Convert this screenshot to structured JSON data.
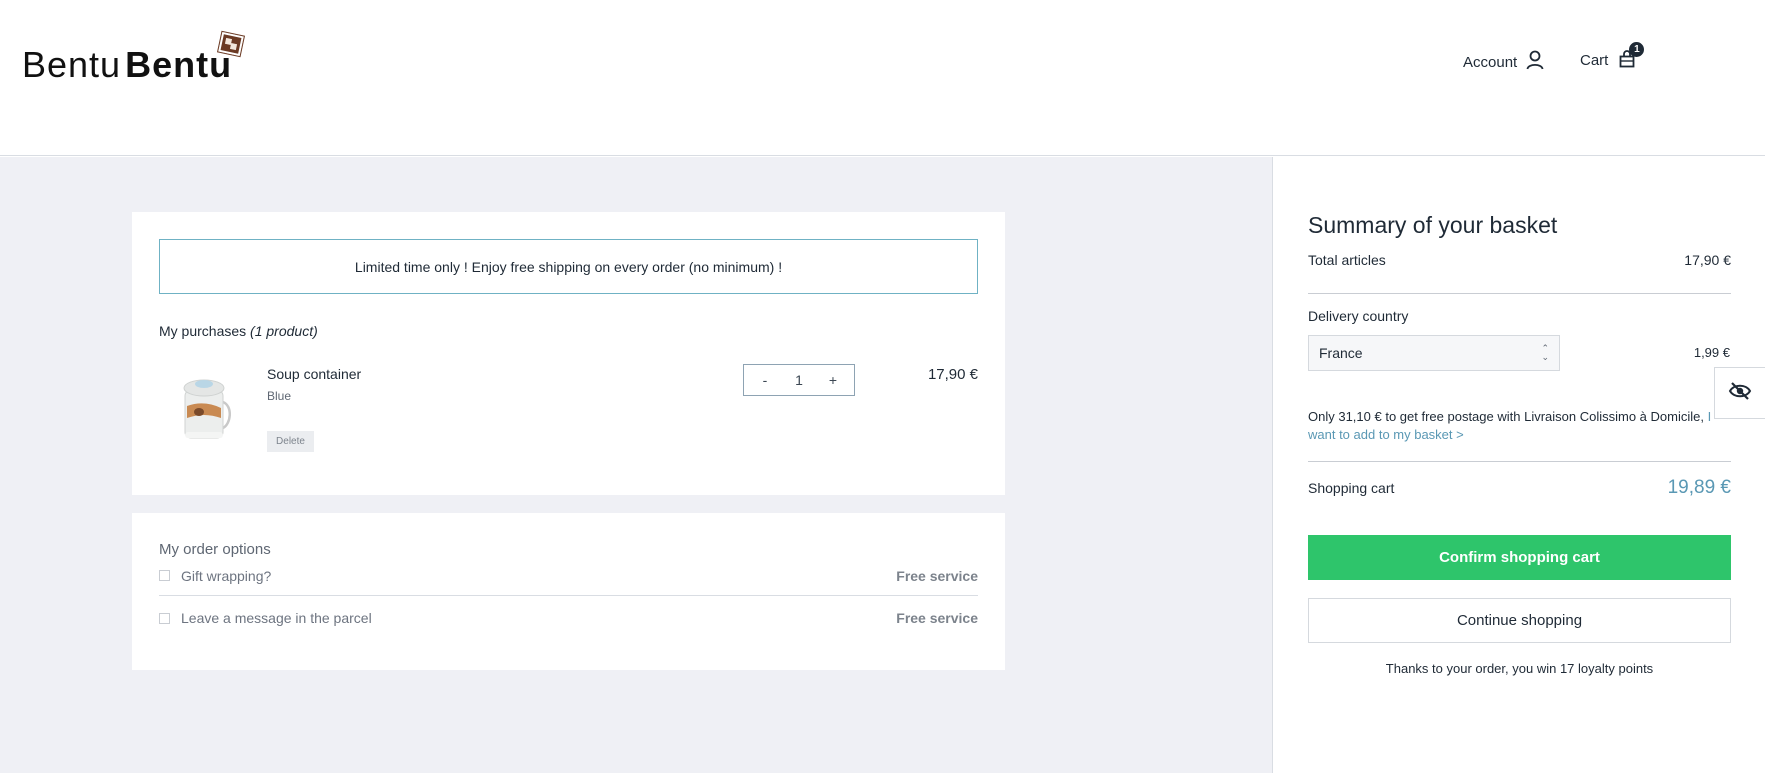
{
  "brand": {
    "name_light": "Bentu",
    "name_bold": "Bentu"
  },
  "nav": {
    "account_label": "Account",
    "cart_label": "Cart",
    "cart_count": "1"
  },
  "promo": {
    "text": "Limited time only ! Enjoy free shipping on every order  (no minimum) !"
  },
  "purchases": {
    "title": "My purchases",
    "count_text": "(1 product)",
    "items": [
      {
        "name": "Soup container",
        "variant": "Blue",
        "delete_label": "Delete",
        "quantity": "1",
        "minus": "-",
        "plus": "+",
        "price": "17,90 €"
      }
    ]
  },
  "options": {
    "title": "My order options",
    "items": [
      {
        "label": "Gift wrapping?",
        "fee": "Free service"
      },
      {
        "label": "Leave a message in the parcel",
        "fee": "Free service"
      }
    ]
  },
  "summary": {
    "title": "Summary of your basket",
    "total_articles_label": "Total articles",
    "total_articles_value": "17,90 €",
    "delivery_country_label": "Delivery country",
    "delivery_country_value": "France",
    "delivery_price": "1,99 €",
    "free_note_prefix": "Only ",
    "free_note_amount": "31,10 €",
    "free_note_middle": " to get free postage with Livraison Colissimo à Domicile, ",
    "free_note_link": "I want to add to my basket >",
    "shopping_cart_label": "Shopping cart",
    "shopping_cart_value": "19,89 €",
    "confirm_label": "Confirm shopping cart",
    "continue_label": "Continue shopping",
    "loyalty_prefix": "Thanks to your order, you win ",
    "loyalty_points": "17 loyalty points"
  },
  "colors": {
    "accent_green": "#2ec56b",
    "accent_blue": "#5a98b4",
    "page_bg": "#eff0f5"
  },
  "icons": {
    "account": "user-icon",
    "cart": "bag-icon",
    "hide": "eye-slash-icon"
  }
}
